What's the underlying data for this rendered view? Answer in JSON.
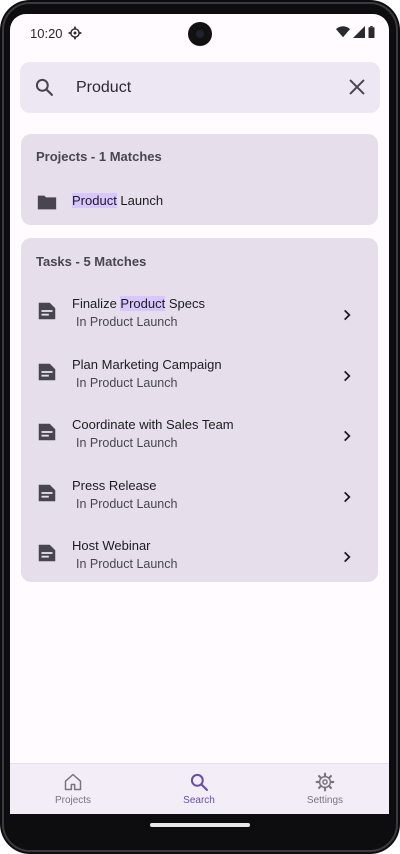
{
  "status": {
    "time": "10:20"
  },
  "search": {
    "value": "Product",
    "placeholder": "Search"
  },
  "projects": {
    "title": "Projects - 1 Matches",
    "items": [
      {
        "highlight": "Product",
        "rest": " Launch"
      }
    ]
  },
  "tasks": {
    "title": "Tasks - 5 Matches",
    "items": [
      {
        "pre": "Finalize ",
        "highlight": "Product",
        "post": " Specs",
        "subtitle": "In Product Launch"
      },
      {
        "pre": "Plan Marketing Campaign",
        "highlight": "",
        "post": "",
        "subtitle": "In Product Launch"
      },
      {
        "pre": "Coordinate with Sales Team",
        "highlight": "",
        "post": "",
        "subtitle": "In Product Launch"
      },
      {
        "pre": "Press Release",
        "highlight": "",
        "post": "",
        "subtitle": "In Product Launch"
      },
      {
        "pre": "Host Webinar",
        "highlight": "",
        "post": "",
        "subtitle": "In Product Launch"
      }
    ]
  },
  "nav": {
    "items": [
      {
        "label": "Projects",
        "icon": "home-icon"
      },
      {
        "label": "Search",
        "icon": "search-icon",
        "active": true
      },
      {
        "label": "Settings",
        "icon": "gear-icon"
      }
    ]
  },
  "colors": {
    "accent": "#6750a4",
    "highlight": "#d7c6ff",
    "card": "#e6dfeb",
    "search_bar": "#ede7f3",
    "nav_bar": "#f3edf7"
  }
}
